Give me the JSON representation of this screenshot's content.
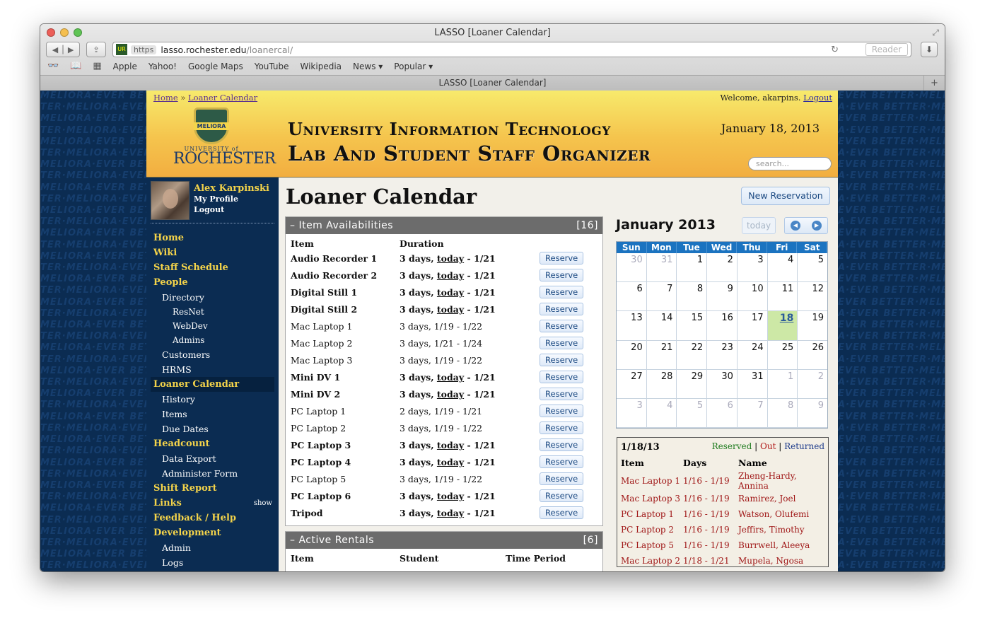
{
  "window": {
    "title": "LASSO [Loaner Calendar]",
    "tab": "LASSO [Loaner Calendar]"
  },
  "url": {
    "scheme": "https",
    "host": "lasso.rochester.edu",
    "path": "/loanercal/"
  },
  "toolbar": {
    "reader": "Reader"
  },
  "bookmarks": [
    "Apple",
    "Yahoo!",
    "Google Maps",
    "YouTube",
    "Wikipedia",
    "News ▾",
    "Popular ▾"
  ],
  "header": {
    "crumb_home": "Home",
    "crumb_sep": " » ",
    "crumb_current": "Loaner Calendar",
    "welcome": "Welcome, akarpins.",
    "logout": "Logout",
    "title1": "University Information Technology",
    "title2": "Lab And Student Staff Organizer",
    "date": "January 18, 2013",
    "search_placeholder": "search...",
    "logo_band": "MELIORA",
    "logo_univ": "UNIVERSITY of",
    "logo_name": "ROCHESTER"
  },
  "profile": {
    "name": "Alex Karpinski",
    "my_profile": "My Profile",
    "logout": "Logout"
  },
  "menu": [
    {
      "label": "Home",
      "level": 0
    },
    {
      "label": "Wiki",
      "level": 0
    },
    {
      "label": "Staff Schedule",
      "level": 0
    },
    {
      "label": "People",
      "level": 0
    },
    {
      "label": "Directory",
      "level": 1
    },
    {
      "label": "ResNet",
      "level": 2
    },
    {
      "label": "WebDev",
      "level": 2
    },
    {
      "label": "Admins",
      "level": 2
    },
    {
      "label": "Customers",
      "level": 1
    },
    {
      "label": "HRMS",
      "level": 1
    },
    {
      "label": "Loaner Calendar",
      "level": 0,
      "active": true
    },
    {
      "label": "History",
      "level": 1
    },
    {
      "label": "Items",
      "level": 1
    },
    {
      "label": "Due Dates",
      "level": 1
    },
    {
      "label": "Headcount",
      "level": 0
    },
    {
      "label": "Data Export",
      "level": 1
    },
    {
      "label": "Administer Form",
      "level": 1
    },
    {
      "label": "Shift Report",
      "level": 0
    },
    {
      "label": "Links",
      "level": 0,
      "extra": "show"
    },
    {
      "label": "Feedback / Help",
      "level": 0
    },
    {
      "label": "Development",
      "level": 0
    },
    {
      "label": "Admin",
      "level": 1
    },
    {
      "label": "Logs",
      "level": 1
    }
  ],
  "page": {
    "title": "Loaner Calendar",
    "new_reservation": "New Reservation"
  },
  "availability": {
    "header": "– Item Availabilities",
    "count": "[16]",
    "col_item": "Item",
    "col_duration": "Duration",
    "reserve_label": "Reserve",
    "rows": [
      {
        "item": "Audio Recorder 1",
        "days": "3 days, ",
        "today": "today",
        "end": " - 1/21",
        "bold": true
      },
      {
        "item": "Audio Recorder 2",
        "days": "3 days, ",
        "today": "today",
        "end": " - 1/21",
        "bold": true
      },
      {
        "item": "Digital Still 1",
        "days": "3 days, ",
        "today": "today",
        "end": " - 1/21",
        "bold": true
      },
      {
        "item": "Digital Still 2",
        "days": "3 days, ",
        "today": "today",
        "end": " - 1/21",
        "bold": true
      },
      {
        "item": "Mac Laptop 1",
        "days": "3 days, 1/19 - 1/22",
        "today": "",
        "end": "",
        "bold": false
      },
      {
        "item": "Mac Laptop 2",
        "days": "3 days, 1/21 - 1/24",
        "today": "",
        "end": "",
        "bold": false
      },
      {
        "item": "Mac Laptop 3",
        "days": "3 days, 1/19 - 1/22",
        "today": "",
        "end": "",
        "bold": false
      },
      {
        "item": "Mini DV 1",
        "days": "3 days, ",
        "today": "today",
        "end": " - 1/21",
        "bold": true
      },
      {
        "item": "Mini DV 2",
        "days": "3 days, ",
        "today": "today",
        "end": " - 1/21",
        "bold": true
      },
      {
        "item": "PC Laptop 1",
        "days": "2 days, 1/19 - 1/21",
        "today": "",
        "end": "",
        "bold": false
      },
      {
        "item": "PC Laptop 2",
        "days": "3 days, 1/19 - 1/22",
        "today": "",
        "end": "",
        "bold": false
      },
      {
        "item": "PC Laptop 3",
        "days": "3 days, ",
        "today": "today",
        "end": " - 1/21",
        "bold": true
      },
      {
        "item": "PC Laptop 4",
        "days": "3 days, ",
        "today": "today",
        "end": " - 1/21",
        "bold": true
      },
      {
        "item": "PC Laptop 5",
        "days": "3 days, 1/19 - 1/22",
        "today": "",
        "end": "",
        "bold": false
      },
      {
        "item": "PC Laptop 6",
        "days": "3 days, ",
        "today": "today",
        "end": " - 1/21",
        "bold": true
      },
      {
        "item": "Tripod",
        "days": "3 days, ",
        "today": "today",
        "end": " - 1/21",
        "bold": true
      }
    ]
  },
  "rentals": {
    "header": "– Active Rentals",
    "count": "[6]",
    "col_item": "Item",
    "col_student": "Student",
    "col_period": "Time Period"
  },
  "calendar": {
    "title": "January 2013",
    "today_btn": "today",
    "days": [
      "Sun",
      "Mon",
      "Tue",
      "Wed",
      "Thu",
      "Fri",
      "Sat"
    ],
    "weeks": [
      [
        "30",
        "31",
        "1",
        "2",
        "3",
        "4",
        "5"
      ],
      [
        "6",
        "7",
        "8",
        "9",
        "10",
        "11",
        "12"
      ],
      [
        "13",
        "14",
        "15",
        "16",
        "17",
        "18",
        "19"
      ],
      [
        "20",
        "21",
        "22",
        "23",
        "24",
        "25",
        "26"
      ],
      [
        "27",
        "28",
        "29",
        "30",
        "31",
        "1",
        "2"
      ],
      [
        "3",
        "4",
        "5",
        "6",
        "7",
        "8",
        "9"
      ]
    ],
    "today": "18"
  },
  "day_detail": {
    "date": "1/18/13",
    "legend_reserved": "Reserved",
    "legend_out": "Out",
    "legend_returned": "Returned",
    "sep": " | ",
    "col_item": "Item",
    "col_days": "Days",
    "col_name": "Name",
    "rows": [
      {
        "item": "Mac Laptop 1",
        "days": "1/16 - 1/19",
        "name": "Zheng-Hardy, Annina"
      },
      {
        "item": "Mac Laptop 3",
        "days": "1/16 - 1/19",
        "name": "Ramirez, Joel"
      },
      {
        "item": "PC Laptop 1",
        "days": "1/16 - 1/19",
        "name": "Watson, Olufemi"
      },
      {
        "item": "PC Laptop 2",
        "days": "1/16 - 1/19",
        "name": "Jeffirs, Timothy"
      },
      {
        "item": "PC Laptop 5",
        "days": "1/16 - 1/19",
        "name": "Burrwell, Aleeya"
      },
      {
        "item": "Mac Laptop 2",
        "days": "1/18 - 1/21",
        "name": "Mupela, Ngosa"
      }
    ]
  }
}
